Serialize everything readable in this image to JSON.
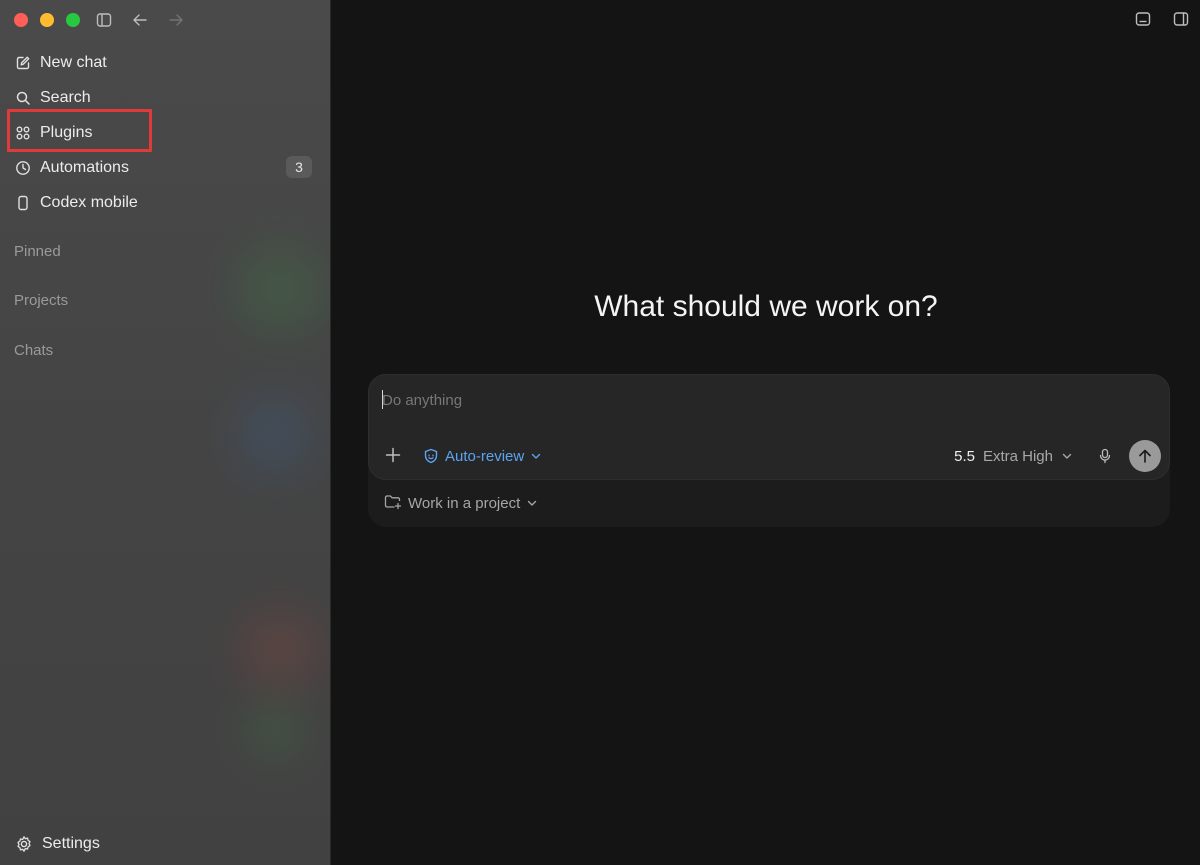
{
  "sidebar": {
    "nav": [
      {
        "label": "New chat",
        "icon": "edit-icon"
      },
      {
        "label": "Search",
        "icon": "search-icon"
      },
      {
        "label": "Plugins",
        "icon": "grid-icon"
      },
      {
        "label": "Automations",
        "icon": "clock-icon",
        "badge": "3"
      },
      {
        "label": "Codex mobile",
        "icon": "phone-icon"
      }
    ],
    "sections": [
      "Pinned",
      "Projects",
      "Chats"
    ],
    "settings_label": "Settings"
  },
  "main": {
    "headline": "What should we work on?",
    "composer": {
      "placeholder": "Do anything",
      "mode_label": "Auto-review",
      "model_version": "5.5",
      "model_level": "Extra High"
    },
    "project_label": "Work in a project"
  },
  "colors": {
    "accent": "#5aa4f0",
    "highlight_border": "#e03a3a"
  }
}
